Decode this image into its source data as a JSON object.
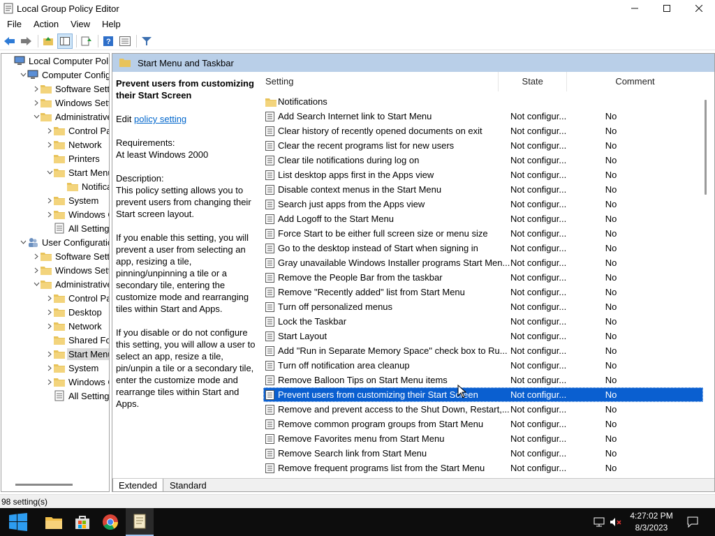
{
  "window": {
    "title": "Local Group Policy Editor"
  },
  "menu": [
    "File",
    "Action",
    "View",
    "Help"
  ],
  "tree": [
    {
      "label": "Local Computer Policy",
      "indent": 0,
      "exp": "",
      "icon": "computer-icon",
      "sel": false
    },
    {
      "label": "Computer Configura",
      "indent": 1,
      "exp": "v",
      "icon": "computer-icon",
      "sel": false
    },
    {
      "label": "Software Settings",
      "indent": 2,
      "exp": ">",
      "icon": "folder-icon",
      "sel": false
    },
    {
      "label": "Windows Settings",
      "indent": 2,
      "exp": ">",
      "icon": "folder-icon",
      "sel": false
    },
    {
      "label": "Administrative T",
      "indent": 2,
      "exp": "v",
      "icon": "folder-icon",
      "sel": false
    },
    {
      "label": "Control Panel",
      "indent": 3,
      "exp": ">",
      "icon": "folder-icon",
      "sel": false
    },
    {
      "label": "Network",
      "indent": 3,
      "exp": ">",
      "icon": "folder-icon",
      "sel": false
    },
    {
      "label": "Printers",
      "indent": 3,
      "exp": "",
      "icon": "folder-icon",
      "sel": false
    },
    {
      "label": "Start Menu a",
      "indent": 3,
      "exp": "v",
      "icon": "folder-icon",
      "sel": false
    },
    {
      "label": "Notificat",
      "indent": 4,
      "exp": "",
      "icon": "folder-icon",
      "sel": false
    },
    {
      "label": "System",
      "indent": 3,
      "exp": ">",
      "icon": "folder-icon",
      "sel": false
    },
    {
      "label": "Windows Co",
      "indent": 3,
      "exp": ">",
      "icon": "folder-icon",
      "sel": false
    },
    {
      "label": "All Settings",
      "indent": 3,
      "exp": "",
      "icon": "settings-list-icon",
      "sel": false
    },
    {
      "label": "User Configuration",
      "indent": 1,
      "exp": "v",
      "icon": "users-icon",
      "sel": false
    },
    {
      "label": "Software Setting",
      "indent": 2,
      "exp": ">",
      "icon": "folder-icon",
      "sel": false
    },
    {
      "label": "Windows Settin",
      "indent": 2,
      "exp": ">",
      "icon": "folder-icon",
      "sel": false
    },
    {
      "label": "Administrative T",
      "indent": 2,
      "exp": "v",
      "icon": "folder-icon",
      "sel": false
    },
    {
      "label": "Control Pane",
      "indent": 3,
      "exp": ">",
      "icon": "folder-icon",
      "sel": false
    },
    {
      "label": "Desktop",
      "indent": 3,
      "exp": ">",
      "icon": "folder-icon",
      "sel": false
    },
    {
      "label": "Network",
      "indent": 3,
      "exp": ">",
      "icon": "folder-icon",
      "sel": false
    },
    {
      "label": "Shared Folde",
      "indent": 3,
      "exp": "",
      "icon": "folder-icon",
      "sel": false
    },
    {
      "label": "Start Menu a",
      "indent": 3,
      "exp": ">",
      "icon": "folder-icon",
      "sel": true
    },
    {
      "label": "System",
      "indent": 3,
      "exp": ">",
      "icon": "folder-icon",
      "sel": false
    },
    {
      "label": "Windows Co",
      "indent": 3,
      "exp": ">",
      "icon": "folder-icon",
      "sel": false
    },
    {
      "label": "All Settings",
      "indent": 3,
      "exp": "",
      "icon": "settings-list-icon",
      "sel": false
    }
  ],
  "right_header": {
    "title": "Start Menu and Taskbar"
  },
  "description": {
    "title": "Prevent users from customizing their Start Screen",
    "edit_prefix": "Edit ",
    "edit_link": "policy setting",
    "requirements_label": "Requirements:",
    "requirements_value": "At least Windows 2000",
    "description_label": "Description:",
    "p1": "This policy setting allows you to prevent users from changing their Start screen layout.",
    "p2": "If you enable this setting, you will prevent a user from selecting an app, resizing a tile, pinning/unpinning a tile or a secondary tile, entering the customize mode and rearranging tiles within Start and Apps.",
    "p3": "If you disable or do not configure this setting, you will allow a user to select an app, resize a tile, pin/unpin a tile or a secondary tile, enter the customize mode and rearrange tiles within Start and Apps."
  },
  "columns": {
    "setting": "Setting",
    "state": "State",
    "comment": "Comment"
  },
  "rows": [
    {
      "setting": "Notifications",
      "state": "",
      "comment": "",
      "icon": "folder-icon"
    },
    {
      "setting": "Add Search Internet link to Start Menu",
      "state": "Not configur...",
      "comment": "No",
      "icon": "policy-icon"
    },
    {
      "setting": "Clear history of recently opened documents on exit",
      "state": "Not configur...",
      "comment": "No",
      "icon": "policy-icon"
    },
    {
      "setting": "Clear the recent programs list for new users",
      "state": "Not configur...",
      "comment": "No",
      "icon": "policy-icon"
    },
    {
      "setting": "Clear tile notifications during log on",
      "state": "Not configur...",
      "comment": "No",
      "icon": "policy-icon"
    },
    {
      "setting": "List desktop apps first in the Apps view",
      "state": "Not configur...",
      "comment": "No",
      "icon": "policy-icon"
    },
    {
      "setting": "Disable context menus in the Start Menu",
      "state": "Not configur...",
      "comment": "No",
      "icon": "policy-icon"
    },
    {
      "setting": "Search just apps from the Apps view",
      "state": "Not configur...",
      "comment": "No",
      "icon": "policy-icon"
    },
    {
      "setting": "Add Logoff to the Start Menu",
      "state": "Not configur...",
      "comment": "No",
      "icon": "policy-icon"
    },
    {
      "setting": "Force Start to be either full screen size or menu size",
      "state": "Not configur...",
      "comment": "No",
      "icon": "policy-icon"
    },
    {
      "setting": "Go to the desktop instead of Start when signing in",
      "state": "Not configur...",
      "comment": "No",
      "icon": "policy-icon"
    },
    {
      "setting": "Gray unavailable Windows Installer programs Start Men...",
      "state": "Not configur...",
      "comment": "No",
      "icon": "policy-icon"
    },
    {
      "setting": "Remove the People Bar from the taskbar",
      "state": "Not configur...",
      "comment": "No",
      "icon": "policy-icon"
    },
    {
      "setting": "Remove \"Recently added\" list from Start Menu",
      "state": "Not configur...",
      "comment": "No",
      "icon": "policy-icon"
    },
    {
      "setting": "Turn off personalized menus",
      "state": "Not configur...",
      "comment": "No",
      "icon": "policy-icon"
    },
    {
      "setting": "Lock the Taskbar",
      "state": "Not configur...",
      "comment": "No",
      "icon": "policy-icon"
    },
    {
      "setting": "Start Layout",
      "state": "Not configur...",
      "comment": "No",
      "icon": "policy-icon"
    },
    {
      "setting": "Add \"Run in Separate Memory Space\" check box to Ru...",
      "state": "Not configur...",
      "comment": "No",
      "icon": "policy-icon"
    },
    {
      "setting": "Turn off notification area cleanup",
      "state": "Not configur...",
      "comment": "No",
      "icon": "policy-icon"
    },
    {
      "setting": "Remove Balloon Tips on Start Menu items",
      "state": "Not configur...",
      "comment": "No",
      "icon": "policy-icon"
    },
    {
      "setting": "Prevent users from customizing their Start Screen",
      "state": "Not configur...",
      "comment": "No",
      "icon": "policy-icon",
      "selected": true
    },
    {
      "setting": "Remove and prevent access to the Shut Down, Restart,...",
      "state": "Not configur...",
      "comment": "No",
      "icon": "policy-icon"
    },
    {
      "setting": "Remove common program groups from Start Menu",
      "state": "Not configur...",
      "comment": "No",
      "icon": "policy-icon"
    },
    {
      "setting": "Remove Favorites menu from Start Menu",
      "state": "Not configur...",
      "comment": "No",
      "icon": "policy-icon"
    },
    {
      "setting": "Remove Search link from Start Menu",
      "state": "Not configur...",
      "comment": "No",
      "icon": "policy-icon"
    },
    {
      "setting": "Remove frequent programs list from the Start Menu",
      "state": "Not configur...",
      "comment": "No",
      "icon": "policy-icon"
    }
  ],
  "tabs": [
    "Extended",
    "Standard"
  ],
  "status": "98 setting(s)",
  "taskbar": {
    "time": "4:27:02 PM",
    "date": "8/3/2023"
  },
  "colors": {
    "selection": "#0a5fd0",
    "header": "#b9cfe8"
  }
}
